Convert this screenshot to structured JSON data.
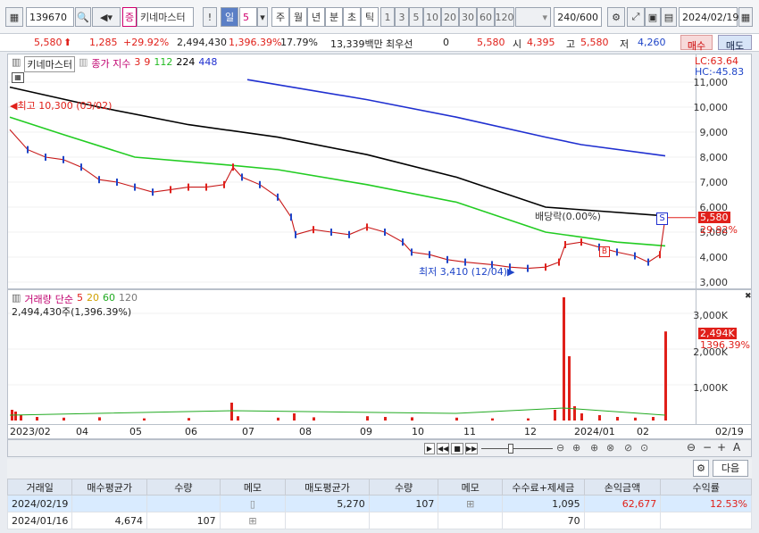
{
  "toolbar": {
    "code": "139670",
    "badge": "증",
    "stock_name": "키네마스터",
    "period_selected": "일",
    "period_number": "5",
    "periods": [
      "주",
      "월",
      "년",
      "분",
      "초",
      "틱"
    ],
    "minutes": [
      "1",
      "3",
      "5",
      "10",
      "20",
      "30",
      "60",
      "120"
    ],
    "count": "240/600",
    "date": "2024/02/19"
  },
  "price": {
    "current": "5,580",
    "change": "1,285",
    "rate": "+29.92%",
    "volume": "2,494,430",
    "volume_rate": "1,396.39%",
    "turnover": "17.79%",
    "amount": "13,339백만",
    "priority_label": "최우선",
    "priority_value": "0",
    "ask": "5,580",
    "open_label": "시",
    "open": "4,395",
    "high_label": "고",
    "high": "5,580",
    "low_label": "저",
    "low": "4,260",
    "buy_label": "매수",
    "sell_label": "매도"
  },
  "price_chart": {
    "title": "키네마스터",
    "legend_label": "종가 지수",
    "ma_labels": [
      "3",
      "9",
      "112",
      "224",
      "448"
    ],
    "lc": "LC:63.64",
    "hc": "HC:-45.83",
    "y_ticks": [
      "11,000",
      "10,000",
      "9,000",
      "8,000",
      "7,000",
      "6,000",
      "5,000",
      "4,000",
      "3,000"
    ],
    "high_note": "최고 10,300 (03/02)",
    "low_note": "최저 3,410 (12/04)",
    "dividend_note": "배당락(0.00%)",
    "last_price_tag": "5,580",
    "last_rate_tag": "29.92%",
    "marker_s": "S",
    "marker_b": "B"
  },
  "volume_chart": {
    "title": "거래량",
    "legend_label": "단순",
    "ma_labels": [
      "5",
      "20",
      "60",
      "120"
    ],
    "current": "2,494,430주(1,396.39%)",
    "y_ticks": [
      "3,000K",
      "2,000K",
      "1,000K"
    ],
    "vol_tag": "2,494K",
    "vol_rate_tag": "1396.39%"
  },
  "x_axis": [
    "2023/02",
    "04",
    "05",
    "06",
    "07",
    "08",
    "09",
    "10",
    "11",
    "12",
    "2024/01",
    "02"
  ],
  "x_axis_right": "02/19",
  "nav": {
    "next_label": "다음"
  },
  "chart_data": {
    "type": "line",
    "title": "키네마스터",
    "series": [
      {
        "name": "3",
        "color": "#e0201a"
      },
      {
        "name": "9",
        "color": "#e0201a"
      },
      {
        "name": "112",
        "color": "#22cc22",
        "values": [
          9600,
          6900,
          4450
        ]
      },
      {
        "name": "224",
        "color": "#000000",
        "values": [
          10800,
          8900,
          5650
        ]
      },
      {
        "name": "448",
        "color": "#1f2fd0",
        "values": [
          11100,
          8050
        ]
      }
    ],
    "ylim": [
      2700,
      11700
    ]
  },
  "table": {
    "headers": [
      "거래일",
      "매수평균가",
      "수량",
      "메모",
      "매도평균가",
      "수량",
      "메모",
      "수수료+제세금",
      "손익금액",
      "수익률"
    ],
    "rows": [
      [
        "2024/02/19",
        "",
        "",
        "",
        "5,270",
        "107",
        "",
        "1,095",
        "62,677",
        "12.53%"
      ],
      [
        "2024/01/16",
        "4,674",
        "107",
        "",
        "",
        "",
        "",
        "70",
        "",
        ""
      ]
    ]
  },
  "colors": {
    "up": "#e0201a",
    "down": "#1f45c8",
    "ma112": "#22cc22",
    "ma224": "#000000",
    "ma448": "#1f2fd0",
    "accent": "#5b7fc6"
  }
}
